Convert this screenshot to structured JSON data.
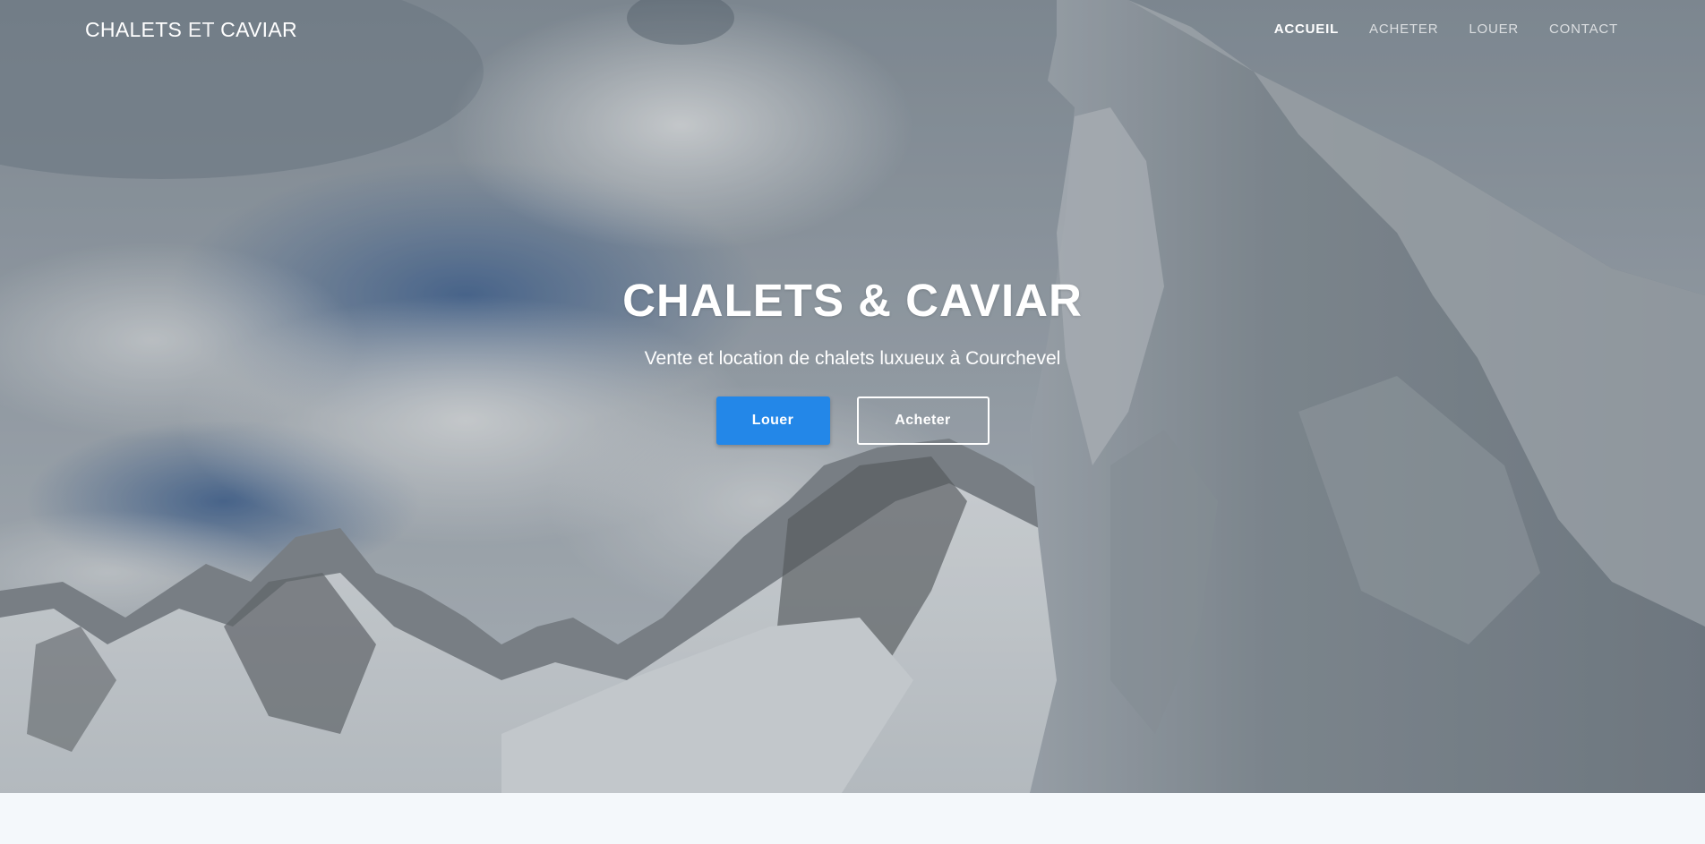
{
  "navbar": {
    "brand_part1": "CHALETS",
    "brand_part2": "ET",
    "brand_part3": "CAVIAR",
    "links": [
      {
        "label": "ACCUEIL",
        "active": true
      },
      {
        "label": "ACHETER",
        "active": false
      },
      {
        "label": "LOUER",
        "active": false
      },
      {
        "label": "CONTACT",
        "active": false
      }
    ]
  },
  "hero": {
    "title": "CHALETS & CAVIAR",
    "subtitle": "Vente et location de chalets luxueux à Courchevel",
    "primary_button": "Louer",
    "secondary_button": "Acheter"
  },
  "colors": {
    "accent": "#2387e8",
    "text": "#ffffff",
    "page_background": "#f4f8fb"
  }
}
